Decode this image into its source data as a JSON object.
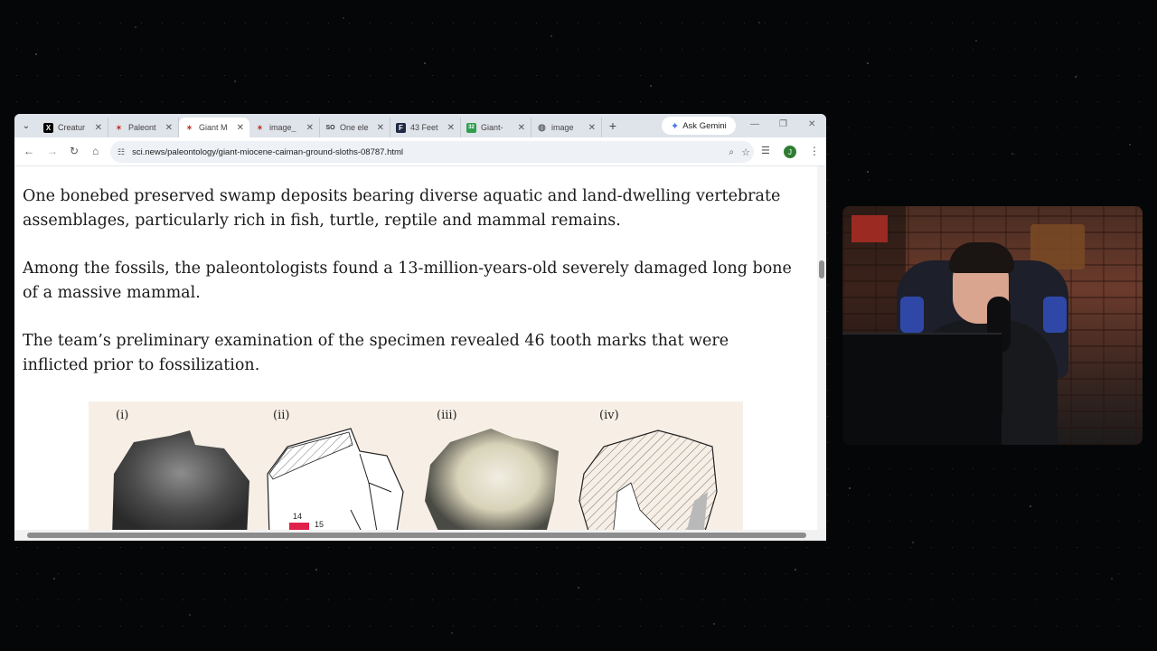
{
  "browser": {
    "tabs": [
      {
        "title": "Creatur",
        "icon": "x-logo-icon",
        "active": false
      },
      {
        "title": "Paleont",
        "icon": "sci-news-favicon-icon",
        "active": false
      },
      {
        "title": "Giant M",
        "icon": "sci-news-favicon-icon",
        "active": true
      },
      {
        "title": "image_",
        "icon": "sci-news-favicon-icon",
        "active": false
      },
      {
        "title": "One ele",
        "icon": "so-favicon-icon",
        "active": false
      },
      {
        "title": "43 Feet",
        "icon": "f-favicon-icon",
        "active": false
      },
      {
        "title": "Giant-",
        "icon": "green-favicon-icon",
        "active": false
      },
      {
        "title": "image",
        "icon": "globe-icon",
        "active": false
      }
    ],
    "ask_gemini": "Ask Gemini",
    "url": "sci.news/paleontology/giant-miocene-caiman-ground-sloths-08787.html",
    "avatar_letter": "J"
  },
  "article": {
    "paragraphs": [
      "One bonebed preserved swamp deposits bearing diverse aquatic and land-dwelling vertebrate assemblages, particularly rich in fish, turtle, reptile and mammal remains.",
      "Among the fossils, the paleontologists found a 13-million-years-old severely damaged long bone of a massive mammal.",
      "The team’s preliminary examination of the specimen revealed 46 tooth marks that were inflicted prior to fossilization."
    ],
    "figure": {
      "labels": [
        "(i)",
        "(ii)",
        "(iii)",
        "(iv)"
      ],
      "mark_numbers": [
        "14",
        "15"
      ]
    }
  },
  "colors": {
    "accent_blue": "#4a78e6",
    "tab_strip": "#dfe3ea",
    "url_bar": "#eef1f6",
    "avatar_green": "#2e7d32",
    "tooth_mark_red": "#e0204a"
  }
}
